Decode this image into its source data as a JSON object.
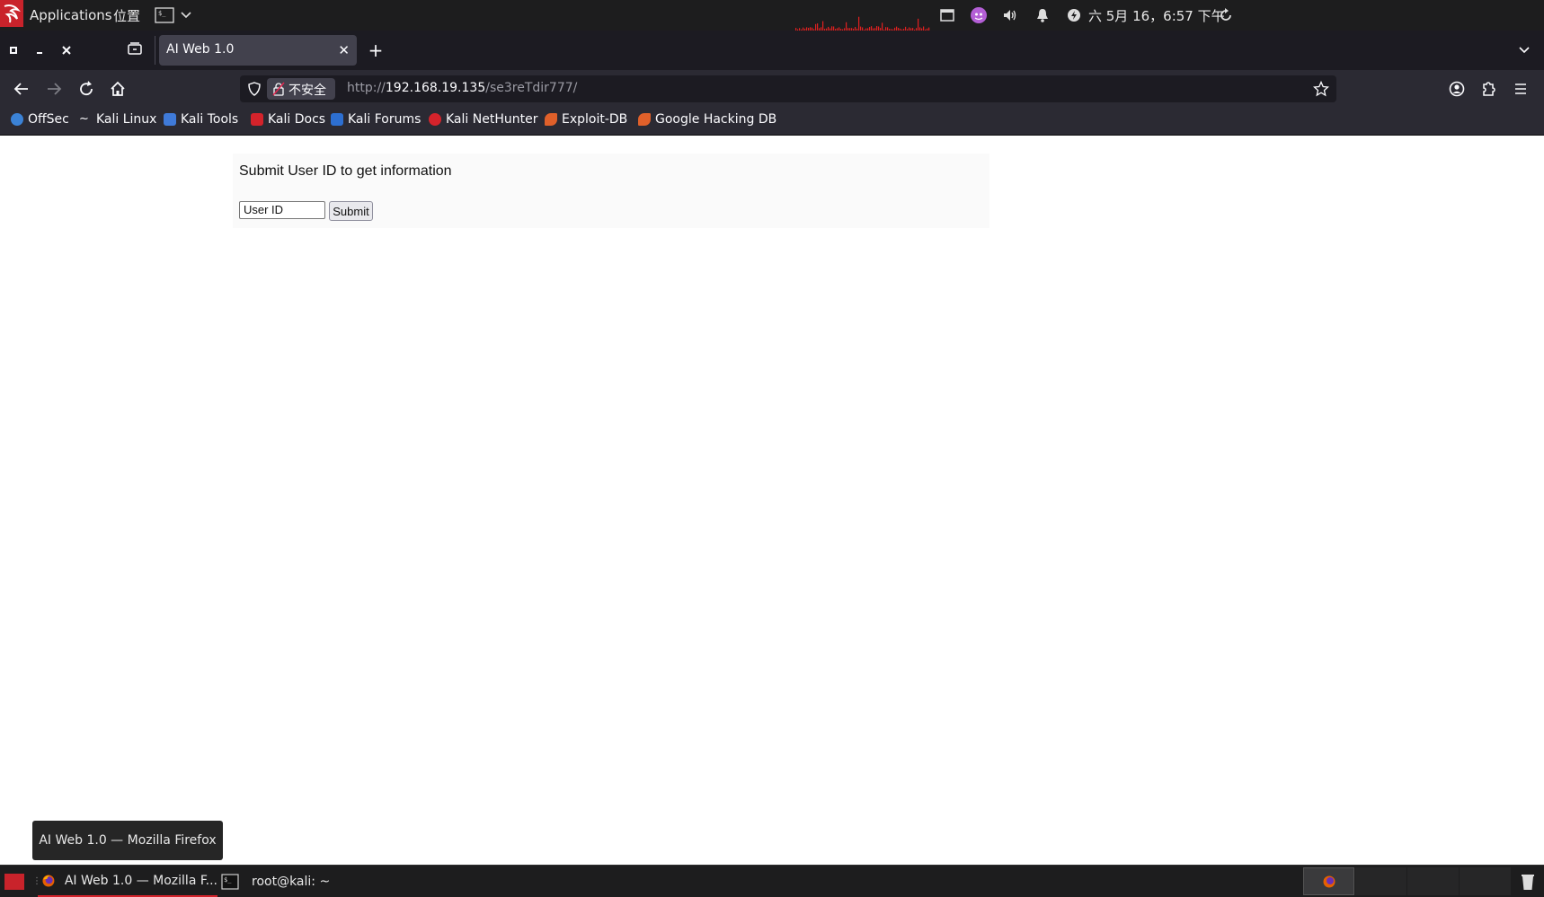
{
  "system_panel": {
    "applications_label": "Applications",
    "places_label": "位置",
    "clock": "六 5月 16，6:57 下午",
    "accent_color": "#c9232b"
  },
  "browser": {
    "tab_title": "AI Web 1.0",
    "not_secure_label": "不安全",
    "url_scheme": "http://",
    "url_host": "192.168.19.135",
    "url_path": "/se3reTdir777/"
  },
  "bookmarks": [
    {
      "label": "OffSec",
      "icon": "offsec-icon"
    },
    {
      "label": "Kali Linux",
      "icon": "kali-dragon-icon"
    },
    {
      "label": "Kali Tools",
      "icon": "kali-tools-icon"
    },
    {
      "label": "Kali Docs",
      "icon": "kali-docs-icon"
    },
    {
      "label": "Kali Forums",
      "icon": "kali-forums-icon"
    },
    {
      "label": "Kali NetHunter",
      "icon": "nethunter-icon"
    },
    {
      "label": "Exploit-DB",
      "icon": "exploit-db-icon"
    },
    {
      "label": "Google Hacking DB",
      "icon": "ghdb-icon"
    }
  ],
  "page": {
    "prompt": "Submit User ID to get information",
    "userid_value": "User ID",
    "submit_label": "Submit"
  },
  "tooltip": "AI Web 1.0 — Mozilla Firefox",
  "taskbar": {
    "firefox_item": "AI Web 1.0 — Mozilla F...",
    "terminal_item": "root@kali: ~"
  }
}
